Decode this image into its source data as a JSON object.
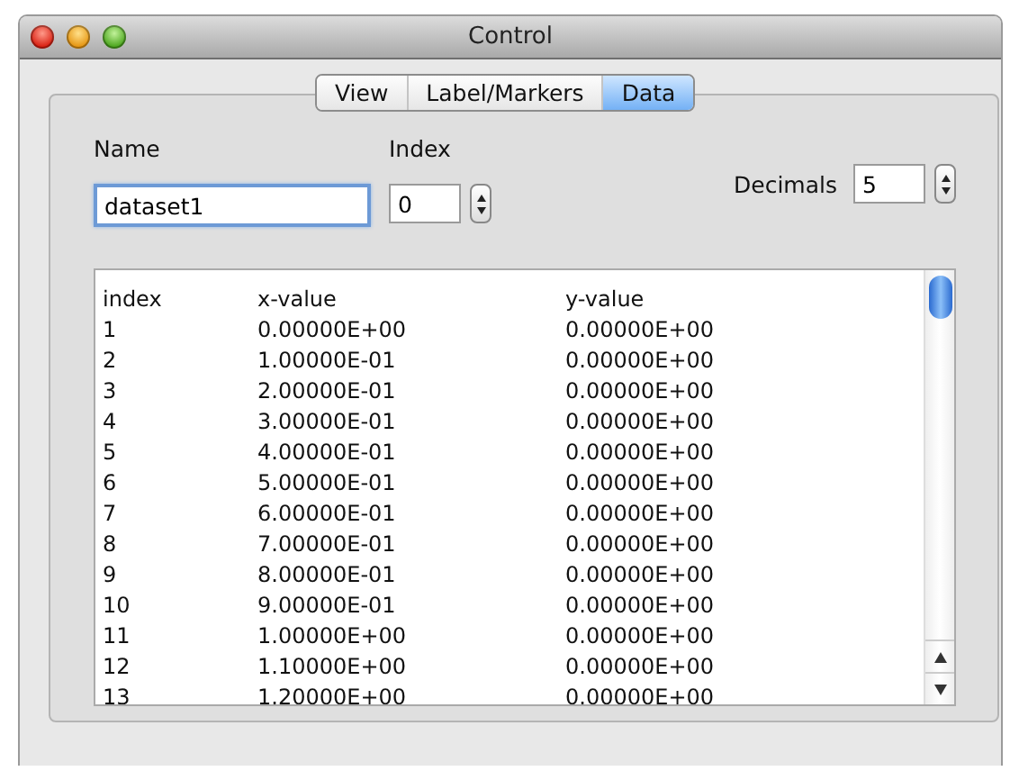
{
  "window": {
    "title": "Control"
  },
  "tabs": [
    {
      "label": "View",
      "selected": false
    },
    {
      "label": "Label/Markers",
      "selected": false
    },
    {
      "label": "Data",
      "selected": true
    }
  ],
  "name_field": {
    "label": "Name",
    "value": "dataset1",
    "focused": true
  },
  "index_field": {
    "label": "Index",
    "value": "0"
  },
  "decimals_field": {
    "label": "Decimals",
    "value": "5"
  },
  "table": {
    "columns": [
      "index",
      "x-value",
      "y-value"
    ],
    "rows": [
      [
        "1",
        "0.00000E+00",
        "0.00000E+00"
      ],
      [
        "2",
        "1.00000E-01",
        "0.00000E+00"
      ],
      [
        "3",
        "2.00000E-01",
        "0.00000E+00"
      ],
      [
        "4",
        "3.00000E-01",
        "0.00000E+00"
      ],
      [
        "5",
        "4.00000E-01",
        "0.00000E+00"
      ],
      [
        "6",
        "5.00000E-01",
        "0.00000E+00"
      ],
      [
        "7",
        "6.00000E-01",
        "0.00000E+00"
      ],
      [
        "8",
        "7.00000E-01",
        "0.00000E+00"
      ],
      [
        "9",
        "8.00000E-01",
        "0.00000E+00"
      ],
      [
        "10",
        "9.00000E-01",
        "0.00000E+00"
      ],
      [
        "11",
        "1.00000E+00",
        "0.00000E+00"
      ],
      [
        "12",
        "1.10000E+00",
        "0.00000E+00"
      ],
      [
        "13",
        "1.20000E+00",
        "0.00000E+00"
      ]
    ]
  }
}
